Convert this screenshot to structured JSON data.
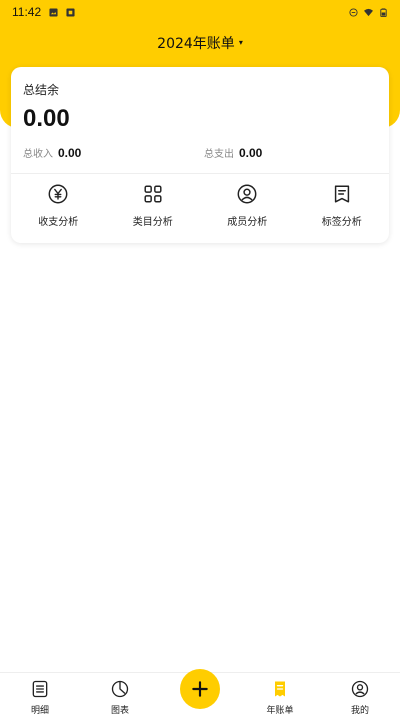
{
  "status_bar": {
    "time": "11:42"
  },
  "header": {
    "title": "2024年账单",
    "caret": "▾"
  },
  "summary": {
    "balance_label": "总结余",
    "balance_value": "0.00",
    "income_label": "总收入",
    "income_value": "0.00",
    "expense_label": "总支出",
    "expense_value": "0.00"
  },
  "analysis": [
    {
      "label": "收支分析",
      "icon": "yen-circle-icon"
    },
    {
      "label": "类目分析",
      "icon": "grid-icon"
    },
    {
      "label": "成员分析",
      "icon": "user-circle-icon"
    },
    {
      "label": "标签分析",
      "icon": "tag-receipt-icon"
    }
  ],
  "bottom_nav": {
    "items": [
      {
        "label": "明细",
        "icon": "list-icon"
      },
      {
        "label": "图表",
        "icon": "pie-chart-icon"
      },
      {
        "label": "年账单",
        "icon": "bill-icon",
        "active": true
      },
      {
        "label": "我的",
        "icon": "profile-icon"
      }
    ],
    "add_button": "+"
  },
  "colors": {
    "accent": "#FFCD00",
    "text": "#111111",
    "muted": "#888888"
  }
}
